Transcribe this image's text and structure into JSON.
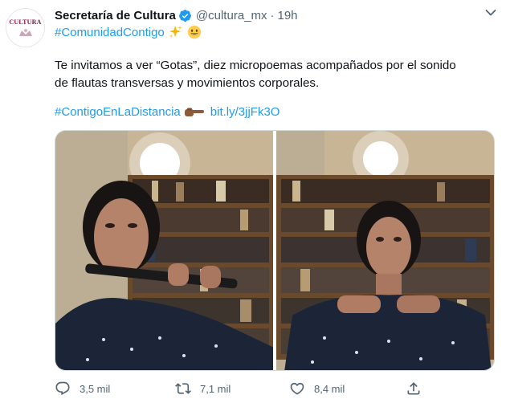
{
  "account": {
    "display_name": "Secretaría de Cultura",
    "handle": "@cultura_mx",
    "separator": "·",
    "time": "19h",
    "avatar_text": "CULTURA"
  },
  "tweet": {
    "hashtag": "#ComunidadContigo",
    "body": "Te invitamos a ver “Gotas”, diez micropoemas acompañados por el sonido de flautas transversas y movimientos corporales.",
    "hashtag2": "#ContigoEnLaDistancia",
    "short_link": "bit.ly/3jjFk3O"
  },
  "icons": {
    "verified": "verified-badge-icon",
    "caret": "chevron-down-icon",
    "sparkles": "sparkles-emoji",
    "smile": "smiling-face-emoji",
    "hand": "pointing-right-hand-emoji",
    "reply": "reply-icon",
    "retweet": "retweet-icon",
    "like": "heart-icon",
    "share": "share-icon"
  },
  "actions": {
    "replies": "3,5 mil",
    "retweets": "7,1 mil",
    "likes": "8,4 mil"
  },
  "colors": {
    "link": "#1d9bf0",
    "muted": "#536471",
    "brand": "#8a1538"
  }
}
